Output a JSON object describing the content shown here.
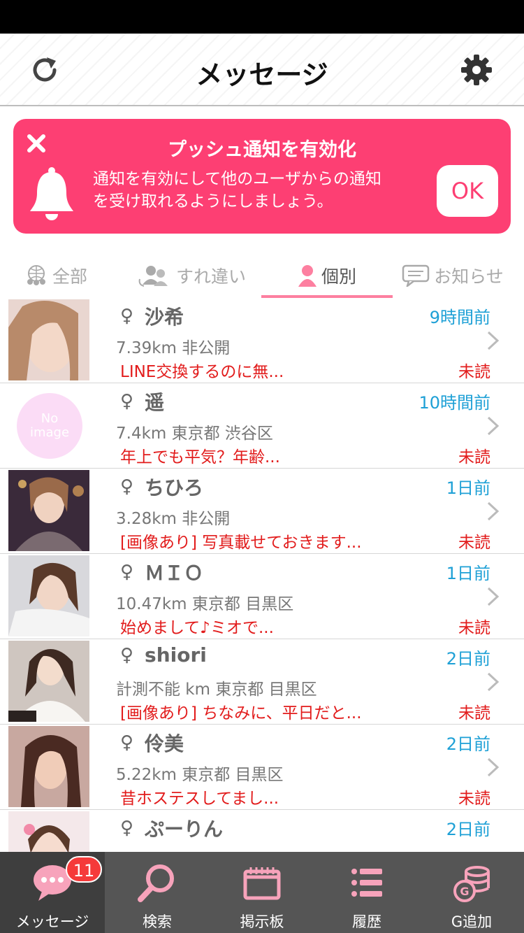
{
  "header": {
    "title": "メッセージ"
  },
  "push_banner": {
    "title": "プッシュ通知を有効化",
    "line1": "通知を有効にして他のユーザからの通知",
    "line2": "を受け取れるようにしましょう。",
    "ok_label": "OK"
  },
  "tabs": [
    {
      "label": "全部",
      "icon": "group-globe-icon"
    },
    {
      "label": "すれ違い",
      "icon": "passing-users-icon"
    },
    {
      "label": "個別",
      "icon": "person-icon",
      "active": true
    },
    {
      "label": "お知らせ",
      "icon": "chat-bubble-icon"
    }
  ],
  "messages": [
    {
      "name": "沙希",
      "time": "9時間前",
      "info": "7.39km  非公開",
      "preview": "LINE交換するのに無...",
      "status": "未読"
    },
    {
      "name": "遥",
      "time": "10時間前",
      "info": "7.4km  東京都 渋谷区",
      "preview": "年上でも平気？年齢...",
      "status": "未読",
      "no_image": true,
      "no_image_text1": "No",
      "no_image_text2": "image"
    },
    {
      "name": "ちひろ",
      "time": "1日前",
      "info": "3.28km  非公開",
      "preview": "[画像あり] 写真載せておきます...",
      "status": "未読"
    },
    {
      "name": "ＭＩＯ",
      "time": "1日前",
      "info": "10.47km  東京都 目黒区",
      "preview": "始めまして♪ミオで...",
      "status": "未読"
    },
    {
      "name": "shiori",
      "time": "2日前",
      "info": "計測不能 km  東京都 目黒区",
      "preview": "[画像あり] ちなみに、平日だと...",
      "status": "未読"
    },
    {
      "name": "伶美",
      "time": "2日前",
      "info": "5.22km  東京都 目黒区",
      "preview": "昔ホステスしてまし...",
      "status": "未読"
    },
    {
      "name": "ぷーりん",
      "time": "2日前",
      "info": "",
      "preview": "",
      "status": ""
    }
  ],
  "female_symbol": "♀",
  "tabbar": {
    "items": [
      {
        "label": "メッセージ",
        "icon": "chat-bubble-icon",
        "badge": "11"
      },
      {
        "label": "検索",
        "icon": "search-icon"
      },
      {
        "label": "掲示板",
        "icon": "bulletin-board-icon"
      },
      {
        "label": "履歴",
        "icon": "list-icon"
      },
      {
        "label": "G追加",
        "icon": "coins-icon"
      }
    ]
  },
  "colors": {
    "accent_pink": "#fd3f73",
    "time_blue": "#1ea0d6",
    "unread_red": "#e21c1c",
    "tabbar": "#555555"
  }
}
